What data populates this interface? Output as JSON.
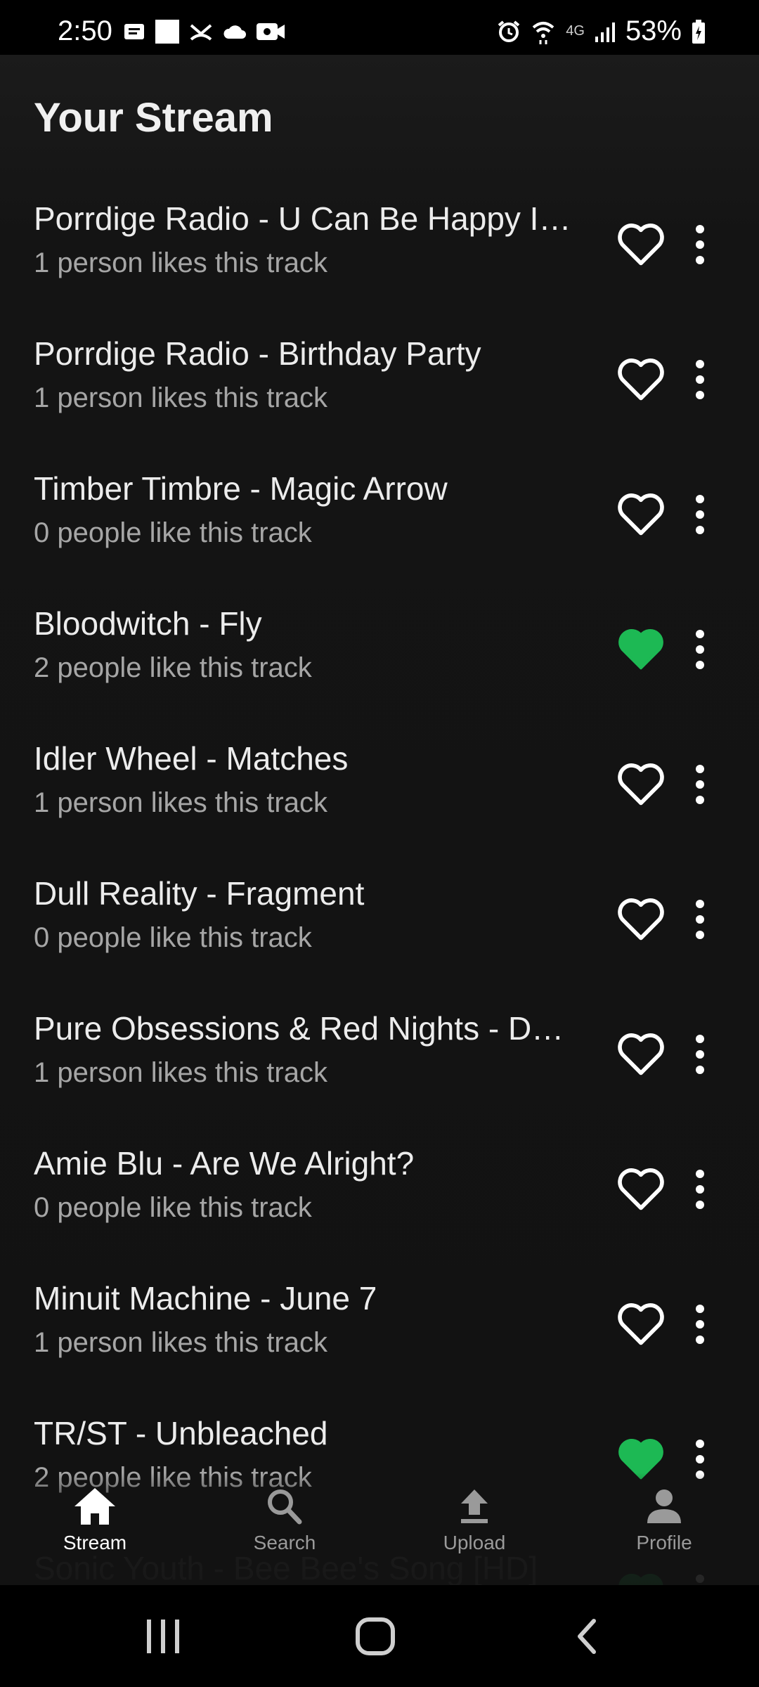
{
  "status_bar": {
    "time": "2:50",
    "battery": "53%",
    "network": "4G",
    "left_icons": [
      "message-icon",
      "square-icon",
      "missed-call-icon",
      "cloud-icon",
      "video-icon"
    ],
    "right_icons": [
      "alarm-icon",
      "wifi-icon",
      "signal-icon",
      "battery-icon"
    ]
  },
  "page": {
    "title": "Your Stream"
  },
  "colors": {
    "background": "#121212",
    "liked_heart": "#1DB954",
    "text": "#ececec",
    "subtext": "#a6a6a6"
  },
  "tracks": [
    {
      "title": "Porrdige Radio - U Can Be Happy If You Want To",
      "likes_text": "1 person likes this track",
      "liked": false
    },
    {
      "title": "Porrdige Radio - Birthday Party",
      "likes_text": "1 person likes this track",
      "liked": false
    },
    {
      "title": "Timber Timbre - Magic Arrow",
      "likes_text": "0 people like this track",
      "liked": false
    },
    {
      "title": "Bloodwitch - Fly",
      "likes_text": "2 people like this track",
      "liked": true
    },
    {
      "title": "Idler Wheel - Matches",
      "likes_text": "1 person likes this track",
      "liked": false
    },
    {
      "title": "Dull Reality - Fragment",
      "likes_text": "0 people like this track",
      "liked": false
    },
    {
      "title": "Pure Obsessions & Red Nights - Desire",
      "likes_text": "1 person likes this track",
      "liked": false
    },
    {
      "title": "Amie Blu - Are We Alright?",
      "likes_text": "0 people like this track",
      "liked": false
    },
    {
      "title": "Minuit Machine - June 7",
      "likes_text": "1 person likes this track",
      "liked": false
    },
    {
      "title": "TR/ST - Unbleached",
      "likes_text": "2 people like this track",
      "liked": true
    },
    {
      "title": "Sonic Youth - Bee Bee's Song [HD]",
      "likes_text": "",
      "liked": true
    }
  ],
  "bottom_nav": [
    {
      "label": "Stream",
      "icon": "home-icon",
      "active": true
    },
    {
      "label": "Search",
      "icon": "search-icon",
      "active": false
    },
    {
      "label": "Upload",
      "icon": "upload-icon",
      "active": false
    },
    {
      "label": "Profile",
      "icon": "person-icon",
      "active": false
    }
  ],
  "system_nav": [
    "recents-button",
    "home-button",
    "back-button"
  ]
}
